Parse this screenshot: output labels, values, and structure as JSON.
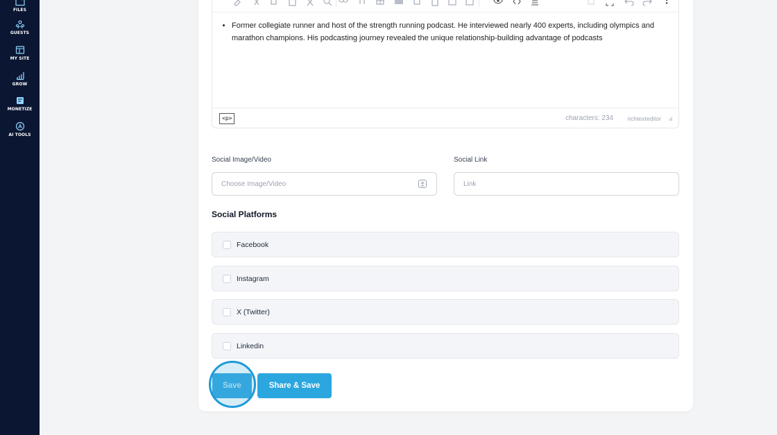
{
  "sidebar": {
    "items": [
      {
        "label": "FILES",
        "icon": "folder-icon"
      },
      {
        "label": "GUESTS",
        "icon": "users-icon"
      },
      {
        "label": "MY SITE",
        "icon": "browser-icon"
      },
      {
        "label": "GROW",
        "icon": "bar-chart-icon"
      },
      {
        "label": "MONETIZE",
        "icon": "wallet-icon"
      },
      {
        "label": "AI TOOLS",
        "icon": "ai-icon"
      }
    ]
  },
  "editor": {
    "toolbar_icons": [
      "eraser-icon",
      "cut-icon",
      "copy-icon",
      "paste-icon",
      "clear-format-icon",
      "search-icon",
      "link-icon",
      "special-char-icon",
      "table-icon",
      "image-icon",
      "video-icon",
      "file-icon",
      "template-icon",
      "code-block-icon",
      "preview-icon",
      "source-code-icon",
      "paragraph-icon",
      "select-all-icon",
      "fullscreen-icon",
      "undo-icon",
      "redo-icon",
      "more-icon"
    ],
    "content": "Former collegiate runner and host of the strength running podcast. He interviewed nearly 400 experts, including olympics and marathon champions. His podcasting journey revealed the unique relationship-building advantage of podcasts",
    "path_tag": "<p>",
    "char_count": "characters: 234",
    "brand": "richtexteditor"
  },
  "form": {
    "social_image": {
      "label": "Social Image/Video",
      "placeholder": "Choose Image/Video"
    },
    "social_link": {
      "label": "Social Link",
      "placeholder": "Link"
    },
    "platforms_title": "Social Platforms",
    "platforms": [
      {
        "label": "Facebook",
        "checked": false
      },
      {
        "label": "Instagram",
        "checked": false
      },
      {
        "label": "X (Twitter)",
        "checked": false
      },
      {
        "label": "Linkedin",
        "checked": false
      }
    ]
  },
  "actions": {
    "save_label": "Save",
    "share_save_label": "Share & Save"
  },
  "colors": {
    "sidebar_bg": "#0b1633",
    "primary": "#2ba6de",
    "page_bg": "#f3f4f6"
  }
}
